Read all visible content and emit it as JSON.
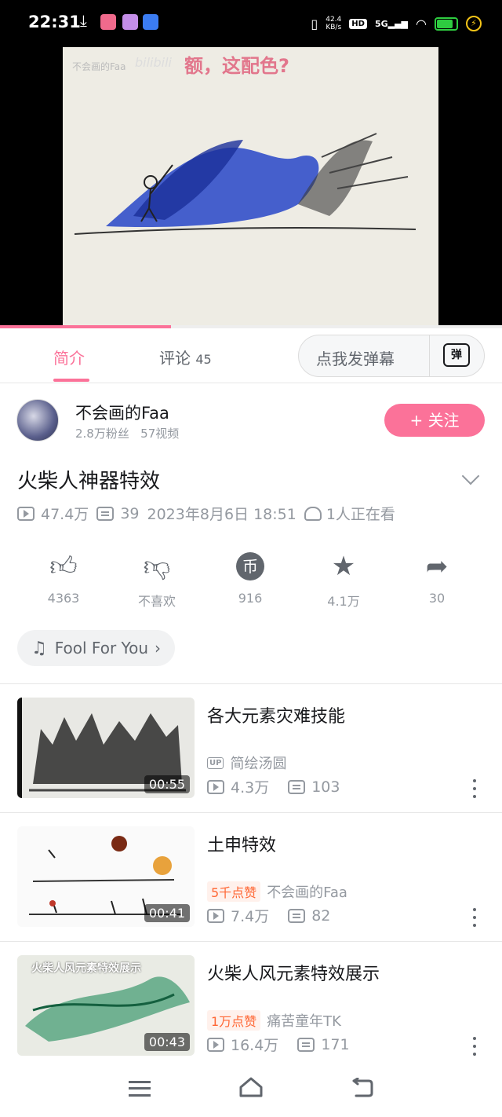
{
  "status_bar": {
    "time": "22:31",
    "net_speed_value": "42.4",
    "net_speed_unit": "KB/s",
    "hd_label": "HD",
    "signal_label": "5G",
    "icons": [
      "download-icon",
      "app-icon",
      "app-icon",
      "baidu-icon",
      "vibrate-icon",
      "wifi-icon",
      "battery-icon",
      "charging-icon"
    ]
  },
  "video": {
    "watermark_uploader": "不会画的Faa",
    "watermark_site": "bilibili",
    "caption": "额，这配色?",
    "progress": 0.34
  },
  "tabs": [
    {
      "label": "简介",
      "active": true
    },
    {
      "label": "评论",
      "count": "45",
      "active": false
    }
  ],
  "danmaku": {
    "placeholder": "点我发弹幕",
    "toggle_glyph": "弹"
  },
  "uploader": {
    "name": "不会画的Faa",
    "fans": "2.8万粉丝",
    "videos": "57视频",
    "follow_label": "关注",
    "follow_icon": "+"
  },
  "video_info": {
    "title": "火柴人神器特效",
    "views": "47.4万",
    "danmaku_count": "39",
    "date": "2023年8月6日 18:51",
    "watching": "1人正在看"
  },
  "actions": [
    {
      "icon": "like-icon",
      "label": "4363"
    },
    {
      "icon": "dislike-icon",
      "label": "不喜欢"
    },
    {
      "icon": "coin-icon",
      "label": "916",
      "glyph": "币"
    },
    {
      "icon": "favorite-icon",
      "label": "4.1万"
    },
    {
      "icon": "share-icon",
      "label": "30"
    }
  ],
  "music": {
    "label": "Fool For You"
  },
  "related": [
    {
      "title": "各大元素灾难技能",
      "duration": "00:55",
      "author_badge": "UP",
      "author": "简绘汤圆",
      "likes_badge": "",
      "views": "4.3万",
      "danmaku": "103"
    },
    {
      "title": "土申特效",
      "duration": "00:41",
      "author_badge": "",
      "author": "不会画的Faa",
      "likes_badge": "5千点赞",
      "views": "7.4万",
      "danmaku": "82"
    },
    {
      "title": "火柴人风元素特效展示",
      "duration": "00:43",
      "author_badge": "",
      "author": "痛苦童年TK",
      "likes_badge": "1万点赞",
      "views": "16.4万",
      "danmaku": "171",
      "thumb_text": "火柴人风元素特效展示"
    }
  ],
  "colors": {
    "accent": "#fb7299",
    "text": "#18191c",
    "muted": "#9499a0",
    "icon": "#61666d"
  }
}
